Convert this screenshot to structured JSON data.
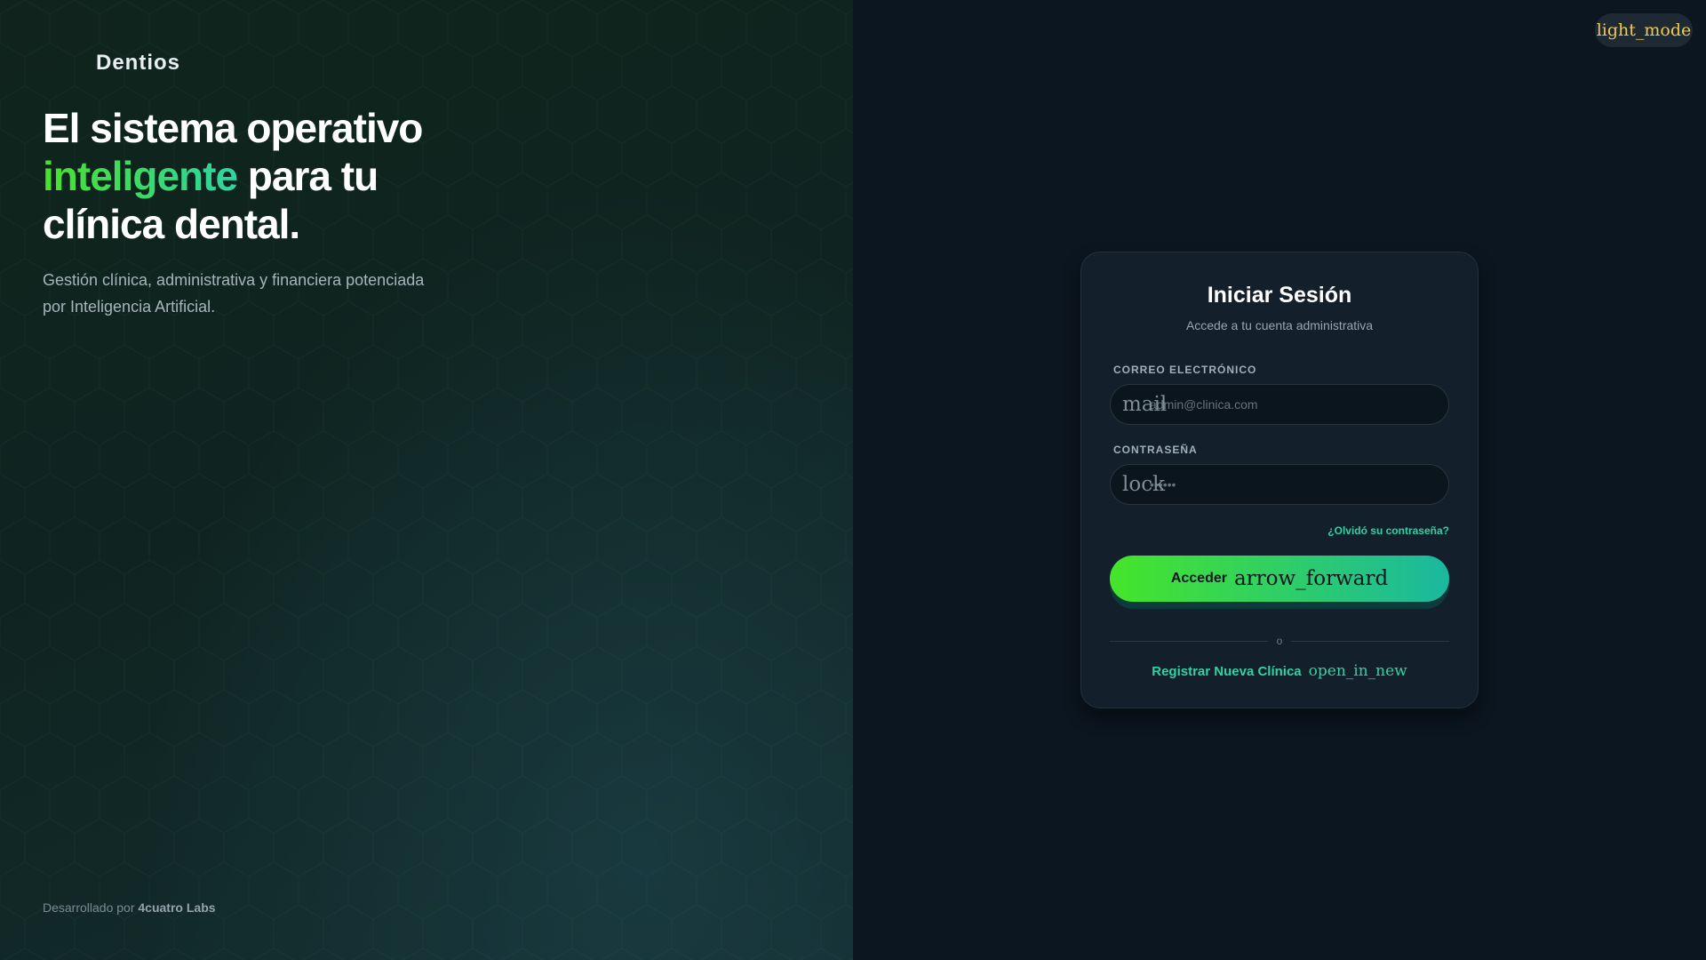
{
  "brand": {
    "name": "Dentios"
  },
  "hero": {
    "line1": "El sistema operativo",
    "accent": "inteligente",
    "line2_rest": " para tu",
    "line3": "clínica dental.",
    "subtitle": "Gestión clínica, administrativa y financiera potenciada por Inteligencia Artificial."
  },
  "footer": {
    "prefix": "Desarrollado por",
    "company": "4cuatro Labs"
  },
  "theme_toggle": {
    "icon_text": "light_mode"
  },
  "login": {
    "title": "Iniciar Sesión",
    "subtitle": "Accede a tu cuenta administrativa",
    "email": {
      "label": "CORREO ELECTRÓNICO",
      "icon_text": "mail",
      "placeholder": "admin@clinica.com",
      "value": ""
    },
    "password": {
      "label": "CONTRASEÑA",
      "icon_text": "lock",
      "placeholder": "••••••",
      "value": ""
    },
    "forgot": "¿Olvidó su contraseña?",
    "submit": {
      "label": "Acceder",
      "icon_text": "arrow_forward"
    },
    "divider": "o",
    "register": {
      "label": "Registrar Nueva Clínica",
      "icon_text": "open_in_new"
    }
  },
  "colors": {
    "accent_green": "#45e52a",
    "accent_teal": "#2fd3a3",
    "page_bg": "#0b1620",
    "card_bg": "#13202b"
  }
}
